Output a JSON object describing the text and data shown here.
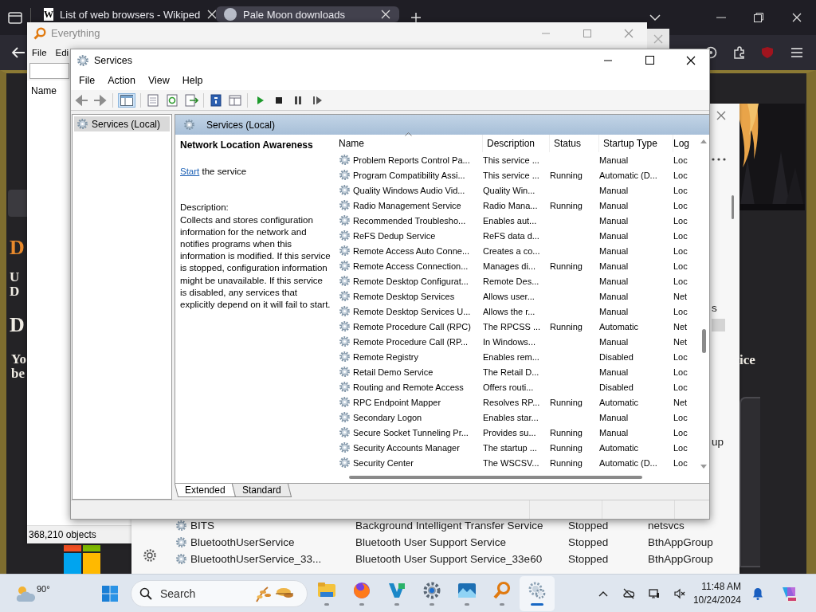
{
  "browser": {
    "tabs": [
      {
        "favicon": "W",
        "label": "List of web browsers - Wikiped",
        "selected": false
      },
      {
        "label": "Pale Moon downloads",
        "selected": true
      }
    ],
    "page": {
      "left_fragments": [
        {
          "text": "D",
          "kind": "heading"
        },
        {
          "text": "U",
          "kind": "body"
        },
        {
          "text": "D",
          "kind": "body"
        },
        {
          "text": "D",
          "kind": "title"
        },
        {
          "text": "Yo",
          "kind": "body"
        },
        {
          "text": "be",
          "kind": "body"
        }
      ],
      "right_fragments": [
        {
          "text": "ice",
          "kind": "body"
        }
      ]
    }
  },
  "everything": {
    "title": "Everything",
    "menu": [
      "File",
      "Edi"
    ],
    "column": "Name",
    "status": "368,210 objects"
  },
  "back_window": {
    "fragments": [
      "s",
      "up"
    ],
    "rows": [
      {
        "name": "BITS",
        "description": "Background Intelligent Transfer Service",
        "status": "Stopped",
        "group": "netsvcs"
      },
      {
        "name": "BluetoothUserService",
        "description": "Bluetooth User Support Service",
        "status": "Stopped",
        "group": "BthAppGroup"
      },
      {
        "name": "BluetoothUserService_33...",
        "description": "Bluetooth User Support Service_33e60",
        "status": "Stopped",
        "group": "BthAppGroup"
      }
    ]
  },
  "services": {
    "title": "Services",
    "menu": [
      "File",
      "Action",
      "View",
      "Help"
    ],
    "tree": [
      {
        "label": "Services (Local)",
        "selected": true
      }
    ],
    "header": "Services (Local)",
    "details": {
      "title": "Network Location Awareness",
      "link": "Start",
      "link_rest": " the service",
      "description_label": "Description:",
      "description": "Collects and stores configuration information for the network and notifies programs when this information is modified. If this service is stopped, configuration information might be unavailable. If this service is disabled, any services that explicitly depend on it will fail to start."
    },
    "columns": [
      "Name",
      "Description",
      "Status",
      "Startup Type",
      "Log"
    ],
    "rows": [
      {
        "name": "Problem Reports Control Pa...",
        "description": "This service ...",
        "startup": "Manual",
        "log": "Loc",
        "selected": false
      },
      {
        "name": "Program Compatibility Assi...",
        "description": "This service ...",
        "status": "Running",
        "startup": "Automatic (D...",
        "log": "Loc",
        "selected": false
      },
      {
        "name": "Quality Windows Audio Vid...",
        "description": "Quality Win...",
        "startup": "Manual",
        "log": "Loc",
        "selected": false
      },
      {
        "name": "Radio Management Service",
        "description": "Radio Mana...",
        "status": "Running",
        "startup": "Manual",
        "log": "Loc",
        "selected": false
      },
      {
        "name": "Recommended Troublesho...",
        "description": "Enables aut...",
        "startup": "Manual",
        "log": "Loc",
        "selected": false
      },
      {
        "name": "ReFS Dedup Service",
        "description": "ReFS data d...",
        "startup": "Manual",
        "log": "Loc",
        "selected": false
      },
      {
        "name": "Remote Access Auto Conne...",
        "description": "Creates a co...",
        "startup": "Manual",
        "log": "Loc",
        "selected": false
      },
      {
        "name": "Remote Access Connection...",
        "description": "Manages di...",
        "status": "Running",
        "startup": "Manual",
        "log": "Loc",
        "selected": false
      },
      {
        "name": "Remote Desktop Configurat...",
        "description": "Remote Des...",
        "startup": "Manual",
        "log": "Loc",
        "selected": false
      },
      {
        "name": "Remote Desktop Services",
        "description": "Allows user...",
        "startup": "Manual",
        "log": "Net",
        "selected": false
      },
      {
        "name": "Remote Desktop Services U...",
        "description": "Allows the r...",
        "startup": "Manual",
        "log": "Loc",
        "selected": false
      },
      {
        "name": "Remote Procedure Call (RPC)",
        "description": "The RPCSS ...",
        "status": "Running",
        "startup": "Automatic",
        "log": "Net",
        "selected": false
      },
      {
        "name": "Remote Procedure Call (RP...",
        "description": "In Windows...",
        "startup": "Manual",
        "log": "Net",
        "selected": false
      },
      {
        "name": "Remote Registry",
        "description": "Enables rem...",
        "startup": "Disabled",
        "log": "Loc",
        "selected": false
      },
      {
        "name": "Retail Demo Service",
        "description": "The Retail D...",
        "startup": "Manual",
        "log": "Loc",
        "selected": false
      },
      {
        "name": "Routing and Remote Access",
        "description": "Offers routi...",
        "startup": "Disabled",
        "log": "Loc",
        "selected": false
      },
      {
        "name": "RPC Endpoint Mapper",
        "description": "Resolves RP...",
        "status": "Running",
        "startup": "Automatic",
        "log": "Net",
        "selected": false
      },
      {
        "name": "Secondary Logon",
        "description": "Enables star...",
        "startup": "Manual",
        "log": "Loc",
        "selected": false
      },
      {
        "name": "Secure Socket Tunneling Pr...",
        "description": "Provides su...",
        "status": "Running",
        "startup": "Manual",
        "log": "Loc",
        "selected": false
      },
      {
        "name": "Security Accounts Manager",
        "description": "The startup ...",
        "status": "Running",
        "startup": "Automatic",
        "log": "Loc",
        "selected": false
      },
      {
        "name": "Security Center",
        "description": "The WSCSV...",
        "status": "Running",
        "startup": "Automatic (D...",
        "log": "Loc",
        "selected": false
      }
    ],
    "view_tabs": [
      {
        "label": "Extended",
        "selected": true
      },
      {
        "label": "Standard",
        "selected": false
      }
    ]
  },
  "taskbar": {
    "weather": "90°",
    "search": {
      "placeholder": "Search"
    },
    "apps": [
      {
        "kind": "files",
        "selected": false
      },
      {
        "kind": "firefox",
        "selected": false
      },
      {
        "kind": "editor",
        "selected": false
      },
      {
        "kind": "settings",
        "selected": false
      },
      {
        "kind": "photos",
        "selected": false
      },
      {
        "kind": "everything",
        "selected": false
      },
      {
        "kind": "services",
        "selected": true
      }
    ],
    "time": "11:48 AM",
    "date": "10/24/2024"
  }
}
